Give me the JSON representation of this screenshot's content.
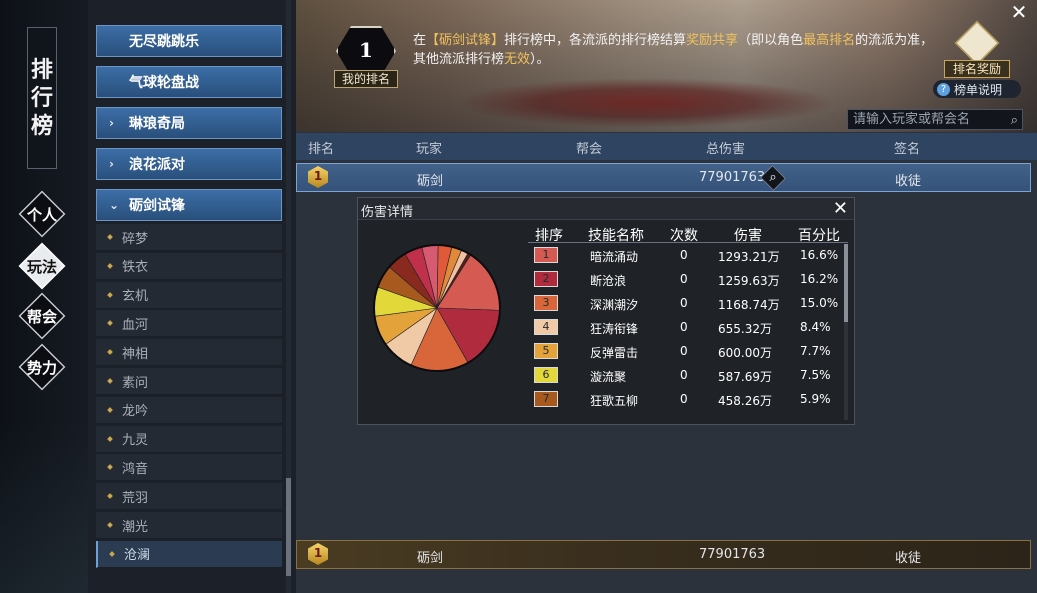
{
  "window": {
    "title_chars": [
      "排",
      "行",
      "榜"
    ],
    "close_icon": "close-icon"
  },
  "side_tabs": [
    {
      "label": "个人",
      "active": false
    },
    {
      "label": "玩法",
      "active": true
    },
    {
      "label": "帮会",
      "active": false
    },
    {
      "label": "势力",
      "active": false
    }
  ],
  "categories": [
    {
      "label": "无尽跳跳乐",
      "arrow": ""
    },
    {
      "label": "气球轮盘战",
      "arrow": ""
    },
    {
      "label": "琳琅奇局",
      "arrow": "›"
    },
    {
      "label": "浪花派对",
      "arrow": "›"
    },
    {
      "label": "砺剑试锋",
      "arrow": "⌄"
    }
  ],
  "subcategories": [
    "碎梦",
    "铁衣",
    "玄机",
    "血河",
    "神相",
    "素问",
    "龙吟",
    "九灵",
    "鸿音",
    "荒羽",
    "潮光",
    "沧澜"
  ],
  "selected_sub": "沧澜",
  "banner": {
    "my_rank_value": "1",
    "my_rank_label": "我的排名",
    "desc_parts": [
      "在",
      "【砺剑试锋】",
      "排行榜中，各流派的排行榜结算",
      "奖励共享",
      "（即以角色",
      "最高排名",
      "的流派为准，其他流派排行榜",
      "无效",
      "）。"
    ],
    "reward_label": "排名奖励",
    "guide_label": "榜单说明",
    "guide_icon": "?"
  },
  "search": {
    "placeholder": "请输入玩家或帮会名"
  },
  "table": {
    "headers": [
      "排名",
      "玩家",
      "帮会",
      "总伤害",
      "签名"
    ],
    "rows": [
      {
        "rank": "1",
        "player": "砺剑",
        "guild": "",
        "damage": "77901763",
        "signature": "收徒"
      }
    ],
    "my_row": {
      "rank": "1",
      "player": "砺剑",
      "guild": "",
      "damage": "77901763",
      "signature": "收徒"
    }
  },
  "popup": {
    "title": "伤害详情",
    "headers": [
      "排序",
      "技能名称",
      "次数",
      "伤害",
      "百分比"
    ],
    "rows": [
      {
        "rank": "1",
        "skill": "暗流涌动",
        "count": "0",
        "damage": "1293.21万",
        "pct": "16.6%",
        "color": "#d45a52"
      },
      {
        "rank": "2",
        "skill": "断沧浪",
        "count": "0",
        "damage": "1259.63万",
        "pct": "16.2%",
        "color": "#b02b3d"
      },
      {
        "rank": "3",
        "skill": "深渊潮汐",
        "count": "0",
        "damage": "1168.74万",
        "pct": "15.0%",
        "color": "#d9663a"
      },
      {
        "rank": "4",
        "skill": "狂涛衔锋",
        "count": "0",
        "damage": "655.32万",
        "pct": "8.4%",
        "color": "#f0c9a6"
      },
      {
        "rank": "5",
        "skill": "反弹雷击",
        "count": "0",
        "damage": "600.00万",
        "pct": "7.7%",
        "color": "#e3a33a"
      },
      {
        "rank": "6",
        "skill": "漩流聚",
        "count": "0",
        "damage": "587.69万",
        "pct": "7.5%",
        "color": "#e2d83a"
      },
      {
        "rank": "7",
        "skill": "狂歌五柳",
        "count": "0",
        "damage": "458.26万",
        "pct": "5.9%",
        "color": "#a85a1e"
      }
    ]
  },
  "pie_others": [
    {
      "pct": 5.2,
      "color": "#8a2a1e"
    },
    {
      "pct": 4.6,
      "color": "#c0304a"
    },
    {
      "pct": 4.2,
      "color": "#d85a70"
    },
    {
      "pct": 3.5,
      "color": "#e05a3a"
    },
    {
      "pct": 2.6,
      "color": "#e0893a"
    },
    {
      "pct": 1.8,
      "color": "#f0c0a0"
    },
    {
      "pct": 0.8,
      "color": "#5c1e18"
    }
  ]
}
